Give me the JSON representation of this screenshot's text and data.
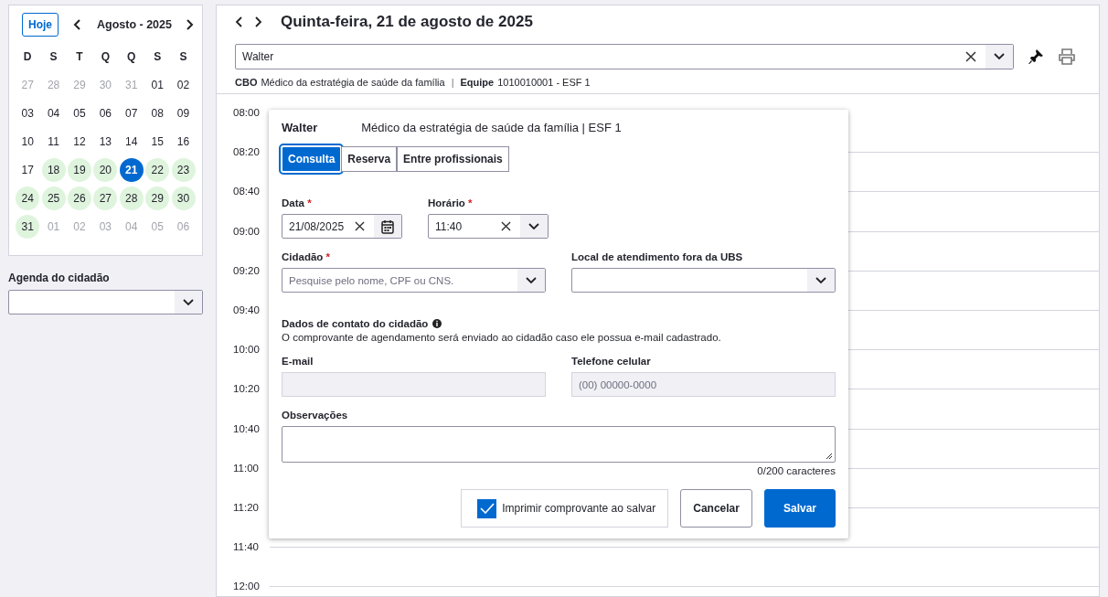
{
  "sidebar": {
    "calendar": {
      "today_button": "Hoje",
      "month": "Agosto - 2025",
      "weekdays": [
        "D",
        "S",
        "T",
        "Q",
        "Q",
        "S",
        "S"
      ],
      "days": [
        {
          "day": "27",
          "muted": true,
          "available": false,
          "selected": false
        },
        {
          "day": "28",
          "muted": true,
          "available": false,
          "selected": false
        },
        {
          "day": "29",
          "muted": true,
          "available": false,
          "selected": false
        },
        {
          "day": "30",
          "muted": true,
          "available": false,
          "selected": false
        },
        {
          "day": "31",
          "muted": true,
          "available": false,
          "selected": false
        },
        {
          "day": "01",
          "muted": false,
          "available": false,
          "selected": false
        },
        {
          "day": "02",
          "muted": false,
          "available": false,
          "selected": false
        },
        {
          "day": "03",
          "muted": false,
          "available": false,
          "selected": false
        },
        {
          "day": "04",
          "muted": false,
          "available": false,
          "selected": false
        },
        {
          "day": "05",
          "muted": false,
          "available": false,
          "selected": false
        },
        {
          "day": "06",
          "muted": false,
          "available": false,
          "selected": false
        },
        {
          "day": "07",
          "muted": false,
          "available": false,
          "selected": false
        },
        {
          "day": "08",
          "muted": false,
          "available": false,
          "selected": false
        },
        {
          "day": "09",
          "muted": false,
          "available": false,
          "selected": false
        },
        {
          "day": "10",
          "muted": false,
          "available": false,
          "selected": false
        },
        {
          "day": "11",
          "muted": false,
          "available": false,
          "selected": false
        },
        {
          "day": "12",
          "muted": false,
          "available": false,
          "selected": false
        },
        {
          "day": "13",
          "muted": false,
          "available": false,
          "selected": false
        },
        {
          "day": "14",
          "muted": false,
          "available": false,
          "selected": false
        },
        {
          "day": "15",
          "muted": false,
          "available": false,
          "selected": false
        },
        {
          "day": "16",
          "muted": false,
          "available": false,
          "selected": false
        },
        {
          "day": "17",
          "muted": false,
          "available": false,
          "selected": false
        },
        {
          "day": "18",
          "muted": false,
          "available": true,
          "selected": false
        },
        {
          "day": "19",
          "muted": false,
          "available": true,
          "selected": false
        },
        {
          "day": "20",
          "muted": false,
          "available": true,
          "selected": false
        },
        {
          "day": "21",
          "muted": false,
          "available": true,
          "selected": true
        },
        {
          "day": "22",
          "muted": false,
          "available": true,
          "selected": false
        },
        {
          "day": "23",
          "muted": false,
          "available": true,
          "selected": false
        },
        {
          "day": "24",
          "muted": false,
          "available": true,
          "selected": false
        },
        {
          "day": "25",
          "muted": false,
          "available": true,
          "selected": false
        },
        {
          "day": "26",
          "muted": false,
          "available": true,
          "selected": false
        },
        {
          "day": "27",
          "muted": false,
          "available": true,
          "selected": false
        },
        {
          "day": "28",
          "muted": false,
          "available": true,
          "selected": false
        },
        {
          "day": "29",
          "muted": false,
          "available": true,
          "selected": false
        },
        {
          "day": "30",
          "muted": false,
          "available": true,
          "selected": false
        },
        {
          "day": "31",
          "muted": false,
          "available": true,
          "selected": false
        },
        {
          "day": "01",
          "muted": true,
          "available": false,
          "selected": false
        },
        {
          "day": "02",
          "muted": true,
          "available": false,
          "selected": false
        },
        {
          "day": "03",
          "muted": true,
          "available": false,
          "selected": false
        },
        {
          "day": "04",
          "muted": true,
          "available": false,
          "selected": false
        },
        {
          "day": "05",
          "muted": true,
          "available": false,
          "selected": false
        },
        {
          "day": "06",
          "muted": true,
          "available": false,
          "selected": false
        }
      ]
    },
    "citizen_agenda": {
      "label": "Agenda do cidadão"
    }
  },
  "header": {
    "date": "Quinta-feira, 21 de agosto de 2025",
    "professional": "Walter",
    "cbo_label": "CBO",
    "cbo": "Médico da estratégia de saúde da família",
    "separator": "|",
    "team_label": "Equipe",
    "team": "1010010001 - ESF 1"
  },
  "schedule": {
    "times": [
      "08:00",
      "08:20",
      "08:40",
      "09:00",
      "09:20",
      "09:40",
      "10:00",
      "10:20",
      "10:40",
      "11:00",
      "11:20",
      "11:40",
      "12:00"
    ]
  },
  "dialog": {
    "name": "Walter",
    "subtitle": "Médico da estratégia de saúde da família | ESF 1",
    "tabs": [
      {
        "label": "Consulta",
        "selected": true
      },
      {
        "label": "Reserva",
        "selected": false
      },
      {
        "label": "Entre profissionais",
        "selected": false
      }
    ],
    "date": {
      "label": "Data",
      "required_mark": "*",
      "value": "21/08/2025"
    },
    "time": {
      "label": "Horário",
      "required_mark": "*",
      "value": "11:40"
    },
    "citizen": {
      "label": "Cidadão",
      "required_mark": "*",
      "placeholder": "Pesquise pelo nome, CPF ou CNS."
    },
    "location": {
      "label": "Local de atendimento fora da UBS"
    },
    "contact_heading": "Dados de contato do cidadão",
    "contact_note": "O comprovante de agendamento será enviado ao cidadão caso ele possua e-mail cadastrado.",
    "email": {
      "label": "E-mail"
    },
    "phone": {
      "label": "Telefone celular",
      "placeholder": "(00) 00000-0000"
    },
    "notes": {
      "label": "Observações",
      "counter": "0/200 caracteres"
    },
    "print_receipt": {
      "label": "Imprimir comprovante ao salvar",
      "checked": true
    },
    "cancel_button": "Cancelar",
    "save_button": "Salvar"
  }
}
